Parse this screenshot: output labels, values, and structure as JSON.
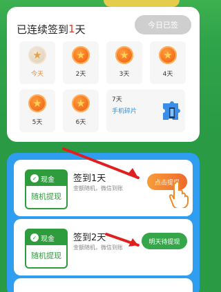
{
  "signin": {
    "prefix": "已连续签到",
    "days": "1",
    "suffix": "天",
    "signed_button": "今日已签",
    "days_list": [
      {
        "label": "今天",
        "state": "done"
      },
      {
        "label": "2天",
        "state": "pending"
      },
      {
        "label": "3天",
        "state": "pending"
      },
      {
        "label": "4天",
        "state": "pending"
      },
      {
        "label": "5天",
        "state": "pending"
      },
      {
        "label": "6天",
        "state": "pending"
      }
    ],
    "day7": {
      "label": "7天",
      "reward": "手机碎片",
      "icon": "puzzle-phone-icon"
    }
  },
  "rewards": [
    {
      "badge_top": "现金",
      "badge_bottom": "随机提现",
      "title": "签到1天",
      "desc": "金额随机，微信到账",
      "button": "点击提现",
      "button_color": "#f17f2f"
    },
    {
      "badge_top": "现金",
      "badge_bottom": "随机提现",
      "title": "签到2天",
      "desc": "金额随机，微信到账",
      "button": "明天待提现",
      "button_color": "#35a64a"
    }
  ],
  "colors": {
    "background": "#2fa44a",
    "accent_orange": "#f08a24",
    "cash_green": "#2e9c3d",
    "reward_panel": "#2f9df0"
  }
}
